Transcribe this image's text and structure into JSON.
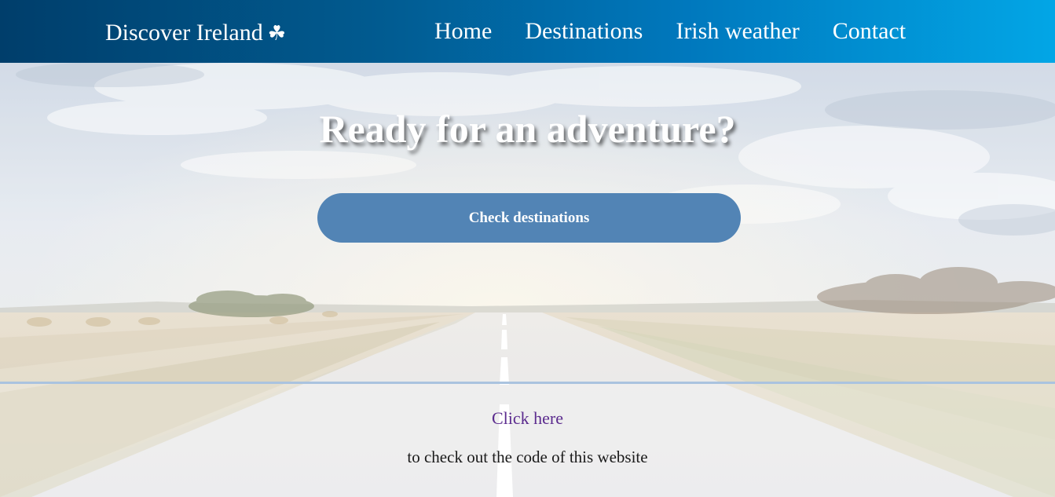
{
  "header": {
    "brand": "Discover Ireland",
    "brand_icon": "shamrock-icon",
    "brand_icon_glyph": "☘",
    "nav": [
      {
        "label": "Home"
      },
      {
        "label": "Destinations"
      },
      {
        "label": "Irish weather"
      },
      {
        "label": "Contact"
      }
    ]
  },
  "hero": {
    "title": "Ready for an adventure?",
    "cta_label": "Check destinations"
  },
  "footer": {
    "link_label": "Click here",
    "text": "to check out the code of this website"
  },
  "colors": {
    "header_start": "#003e6b",
    "header_end": "#02a6e6",
    "cta": "#5284b5",
    "link": "#5b2b8e"
  }
}
